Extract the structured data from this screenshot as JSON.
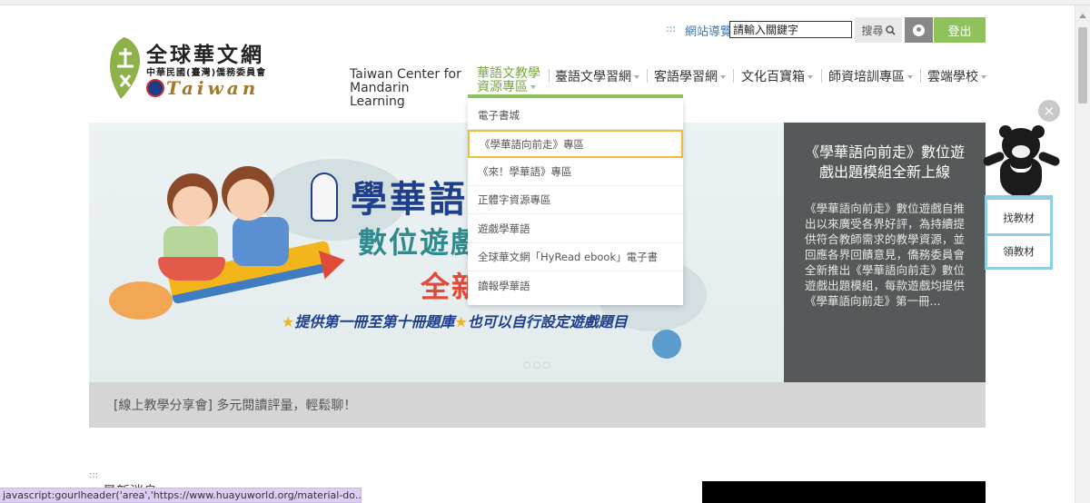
{
  "header": {
    "logo_title": "全球華文網",
    "logo_subtitle": "中華民國(臺灣)僑務委員會",
    "logo_en": "Taiwan",
    "sitemap_dots": ":::",
    "sitemap_label": "網站導覽",
    "search_placeholder": "請輸入關鍵字",
    "search_label": "搜尋",
    "logout_label": "登出"
  },
  "nav": {
    "tcml": "Taiwan Center for Mandarin Learning",
    "active_label": "華語文教學資源專區",
    "items": [
      {
        "label": "臺語文學習網"
      },
      {
        "label": "客語學習網"
      },
      {
        "label": "文化百寶箱"
      },
      {
        "label": "師資培訓專區"
      },
      {
        "label": "雲端學校"
      }
    ]
  },
  "dropdown": {
    "items": [
      {
        "label": "電子書城"
      },
      {
        "label": "《學華語向前走》專區"
      },
      {
        "label": "《來！學華語》專區"
      },
      {
        "label": "正體字資源專區"
      },
      {
        "label": "遊戲學華語"
      },
      {
        "label": "全球華文網「HyRead ebook」電子書"
      },
      {
        "label": "讀報學華語"
      }
    ]
  },
  "hero": {
    "line1": "學華語",
    "line2": "數位遊戲",
    "line3": "全新",
    "tagline_part1": "提供第一冊至第十冊題庫",
    "tagline_part2": "也可以自行設定遊戲題目",
    "panel_title": "《學華語向前走》數位遊戲出題模組全新上線",
    "panel_body": "《學華語向前走》數位遊戲自推出以來廣受各界好評，為持續提供符合教師需求的教學資源，並回應各界回饋意見，僑務委員會全新推出《學華語向前走》數位遊戲出題模組，每款遊戲均提供《學華語向前走》第一冊..."
  },
  "news_bar": {
    "text": "[線上教學分享會] 多元閱讀評量，輕鬆聊！"
  },
  "mascot": {
    "close_glyph": "×",
    "find_label": "找教材",
    "get_label": "領教材"
  },
  "bottom": {
    "dots": ":::",
    "news_title": "最新消息"
  },
  "status_bar": {
    "text": "javascript:gourlheader('area','https://www.huayuworld.org/material-do..."
  },
  "colors": {
    "accent_green": "#8fc15d",
    "panel_gray": "#56595a",
    "highlight_yellow": "#f2b93b",
    "mascot_border": "#90cfe3"
  }
}
